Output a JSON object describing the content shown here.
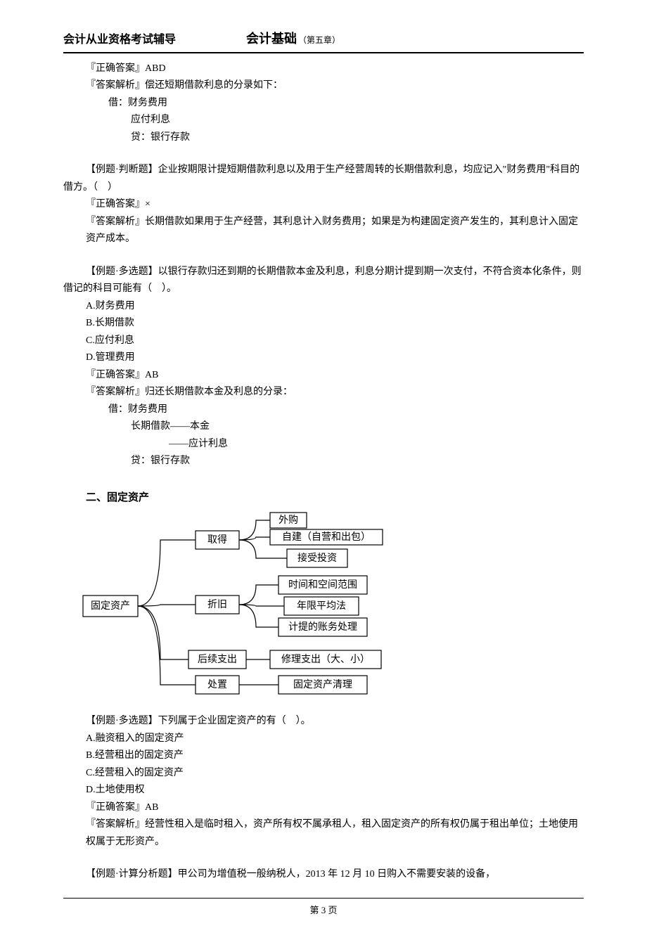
{
  "header": {
    "left": "会计从业资格考试辅导",
    "mid": "会计基础",
    "sub": "（第五章）"
  },
  "q1": {
    "answer_label": "『正确答案』ABD",
    "analysis_label": "『答案解析』偿还短期借款利息的分录如下：",
    "line1": "借：财务费用",
    "line2": "应付利息",
    "line3": "贷：银行存款"
  },
  "q2": {
    "prompt": "【例题·判断题】企业按期限计提短期借款利息以及用于生产经营周转的长期借款利息，均应记入\"财务费用\"科目的借方。（　）",
    "answer_label": "『正确答案』×",
    "analysis": "『答案解析』长期借款如果用于生产经营，其利息计入财务费用；如果是为构建固定资产发生的，其利息计入固定资产成本。"
  },
  "q3": {
    "prompt": "【例题·多选题】以银行存款归还到期的长期借款本金及利息，利息分期计提到期一次支付，不符合资本化条件，则借记的科目可能有（　）。",
    "optA": "A.财务费用",
    "optB": "B.长期借款",
    "optC": "C.应付利息",
    "optD": "D.管理费用",
    "answer_label": "『正确答案』AB",
    "analysis_label": "『答案解析』归还长期借款本金及利息的分录：",
    "line1": "借：财务费用",
    "line2": "长期借款——本金",
    "line3": "——应计利息",
    "line4": "贷：银行存款"
  },
  "section2_title": "二、固定资产",
  "diagram": {
    "root": "固定资产",
    "n1": "取得",
    "n2": "折旧",
    "n3": "后续支出",
    "n4": "处置",
    "l1a": "外购",
    "l1b": "自建（自营和出包）",
    "l1c": "接受投资",
    "l2a": "时间和空间范围",
    "l2b": "年限平均法",
    "l2c": "计提的账务处理",
    "l3a": "修理支出（大、小）",
    "l4a": "固定资产清理"
  },
  "q4": {
    "prompt": "【例题·多选题】下列属于企业固定资产的有（　）。",
    "optA": "A.融资租入的固定资产",
    "optB": "B.经营租出的固定资产",
    "optC": "C.经营租入的固定资产",
    "optD": "D.土地使用权",
    "answer_label": "『正确答案』AB",
    "analysis": "『答案解析』经营性租入是临时租入，资产所有权不属承租人，租入固定资产的所有权仍属于租出单位；土地使用权属于无形资产。"
  },
  "q5": {
    "prompt": "【例题·计算分析题】甲公司为增值税一般纳税人，2013 年 12 月 10 日购入不需要安装的设备，"
  },
  "footer": {
    "page": "第 3 页"
  }
}
